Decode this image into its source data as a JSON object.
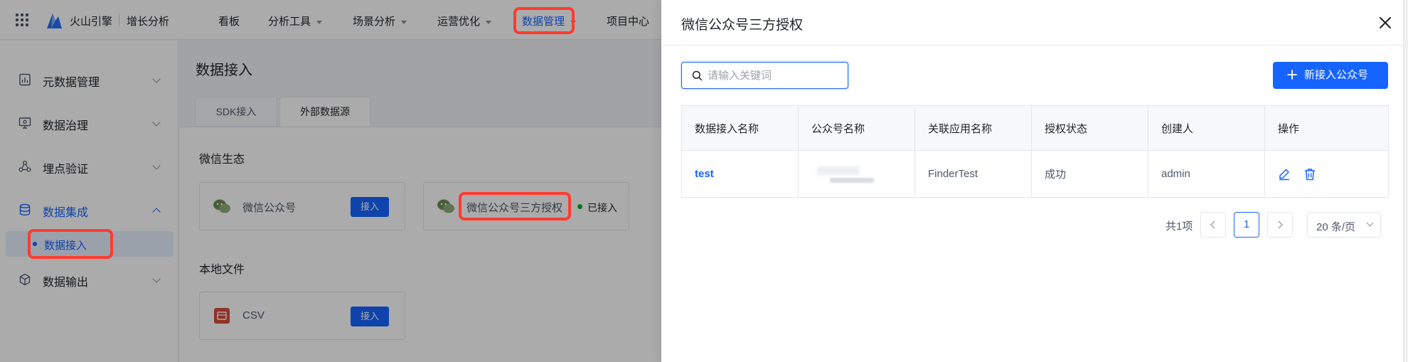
{
  "topbar": {
    "brand": "火山引擎",
    "product": "增长分析",
    "nav": [
      {
        "label": "看板"
      },
      {
        "label": "分析工具"
      },
      {
        "label": "场景分析"
      },
      {
        "label": "运营优化"
      },
      {
        "label": "数据管理"
      },
      {
        "label": "项目中心"
      }
    ]
  },
  "sidebar": {
    "items": [
      {
        "label": "元数据管理"
      },
      {
        "label": "数据治理"
      },
      {
        "label": "埋点验证"
      },
      {
        "label": "数据集成"
      },
      {
        "label": "数据输出"
      }
    ],
    "sub_item": "数据接入"
  },
  "main": {
    "title": "数据接入",
    "tabs": [
      {
        "label": "SDK接入"
      },
      {
        "label": "外部数据源"
      }
    ],
    "section_wechat": "微信生态",
    "card_official": "微信公众号",
    "card_third": "微信公众号三方授权",
    "connect_label": "接入",
    "status_connected": "已接入",
    "section_local": "本地文件",
    "card_csv": "CSV"
  },
  "drawer": {
    "title": "微信公众号三方授权",
    "search_placeholder": "请输入关键词",
    "new_button": "新接入公众号",
    "columns": [
      "数据接入名称",
      "公众号名称",
      "关联应用名称",
      "授权状态",
      "创建人",
      "操作"
    ],
    "rows": [
      {
        "name": "test",
        "app": "FinderTest",
        "status": "成功",
        "creator": "admin"
      }
    ],
    "pagination": {
      "total": "共1项",
      "current": "1",
      "page_size": "20 条/页"
    }
  },
  "colors": {
    "primary": "#1664ff",
    "highlight": "#ff3b30",
    "success": "#00b42a"
  }
}
